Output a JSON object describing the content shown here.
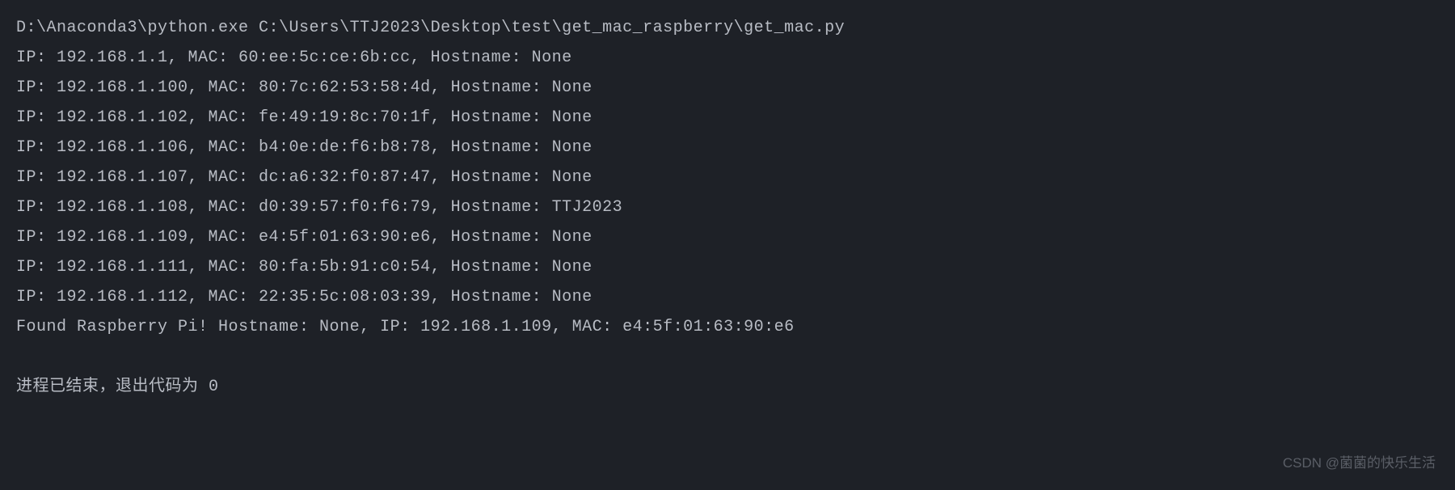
{
  "terminal": {
    "command": "D:\\Anaconda3\\python.exe C:\\Users\\TTJ2023\\Desktop\\test\\get_mac_raspberry\\get_mac.py",
    "entries": [
      {
        "ip": "192.168.1.1",
        "mac": "60:ee:5c:ce:6b:cc",
        "hostname": "None"
      },
      {
        "ip": "192.168.1.100",
        "mac": "80:7c:62:53:58:4d",
        "hostname": "None"
      },
      {
        "ip": "192.168.1.102",
        "mac": "fe:49:19:8c:70:1f",
        "hostname": "None"
      },
      {
        "ip": "192.168.1.106",
        "mac": "b4:0e:de:f6:b8:78",
        "hostname": "None"
      },
      {
        "ip": "192.168.1.107",
        "mac": "dc:a6:32:f0:87:47",
        "hostname": "None"
      },
      {
        "ip": "192.168.1.108",
        "mac": "d0:39:57:f0:f6:79",
        "hostname": "TTJ2023"
      },
      {
        "ip": "192.168.1.109",
        "mac": "e4:5f:01:63:90:e6",
        "hostname": "None"
      },
      {
        "ip": "192.168.1.111",
        "mac": "80:fa:5b:91:c0:54",
        "hostname": "None"
      },
      {
        "ip": "192.168.1.112",
        "mac": "22:35:5c:08:03:39",
        "hostname": "None"
      }
    ],
    "found_line": "Found Raspberry Pi! Hostname: None, IP: 192.168.1.109, MAC: e4:5f:01:63:90:e6",
    "exit_message": "进程已结束，退出代码为 0",
    "labels": {
      "ip_prefix": "IP: ",
      "mac_prefix": ", MAC: ",
      "hostname_prefix": ", Hostname: "
    }
  },
  "watermark": "CSDN @菌菌的快乐生活"
}
